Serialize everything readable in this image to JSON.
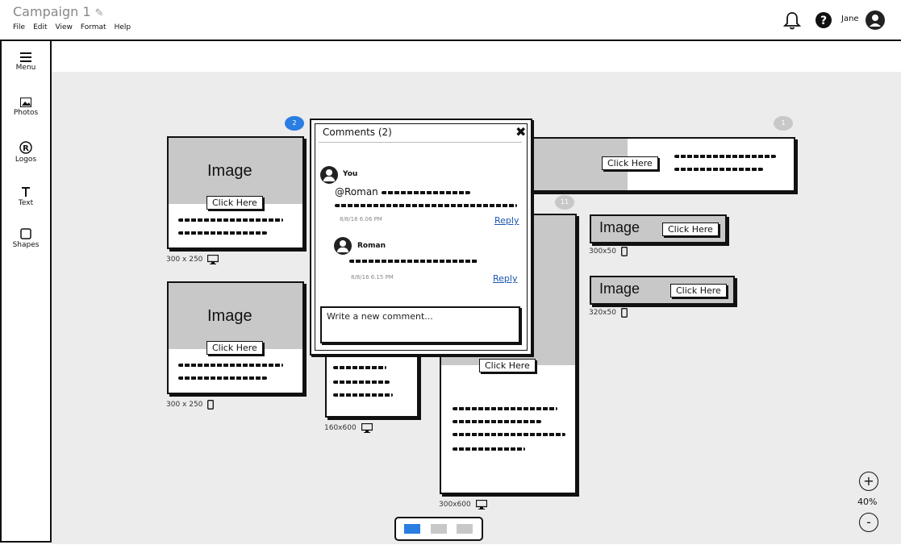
{
  "header": {
    "title": "Campaign 1",
    "menus": [
      "File",
      "Edit",
      "View",
      "Format",
      "Help"
    ],
    "user": "Jane"
  },
  "sidebar": {
    "items": [
      {
        "label": "Menu",
        "icon": "hamburger-icon"
      },
      {
        "label": "Photos",
        "icon": "photo-icon"
      },
      {
        "label": "Logos",
        "icon": "registered-icon"
      },
      {
        "label": "Text",
        "icon": "text-icon"
      },
      {
        "label": "Shapes",
        "icon": "square-icon"
      }
    ]
  },
  "ads": {
    "image_label": "Image",
    "cta": "Click Here",
    "a1": {
      "size": "300 x 250",
      "device": "monitor-icon",
      "comments": "2"
    },
    "a2": {
      "size": "300 x 250",
      "device": "phone-icon"
    },
    "a3": {
      "size": "160x600",
      "device": "monitor-icon"
    },
    "a4": {
      "size": "300x600",
      "device": "monitor-icon",
      "comments": "11"
    },
    "a5": {
      "comments": "1"
    },
    "a6": {
      "size": "300x50",
      "device": "phone-icon"
    },
    "a7": {
      "size": "320x50",
      "device": "phone-icon"
    }
  },
  "comments": {
    "title": "Comments (2)",
    "c1": {
      "author": "You",
      "mention": "@Roman",
      "time": "8/8/16 6.06 PM",
      "reply": "Reply"
    },
    "c2": {
      "author": "Roman",
      "time": "8/8/16 6.15 PM",
      "reply": "Reply"
    },
    "new_placeholder": "Write a new comment..."
  },
  "zoom": {
    "plus": "+",
    "level": "40%",
    "minus": "-"
  },
  "colors": {
    "accent": "#2a7de1",
    "bubble_grey": "#c8c8c8"
  }
}
